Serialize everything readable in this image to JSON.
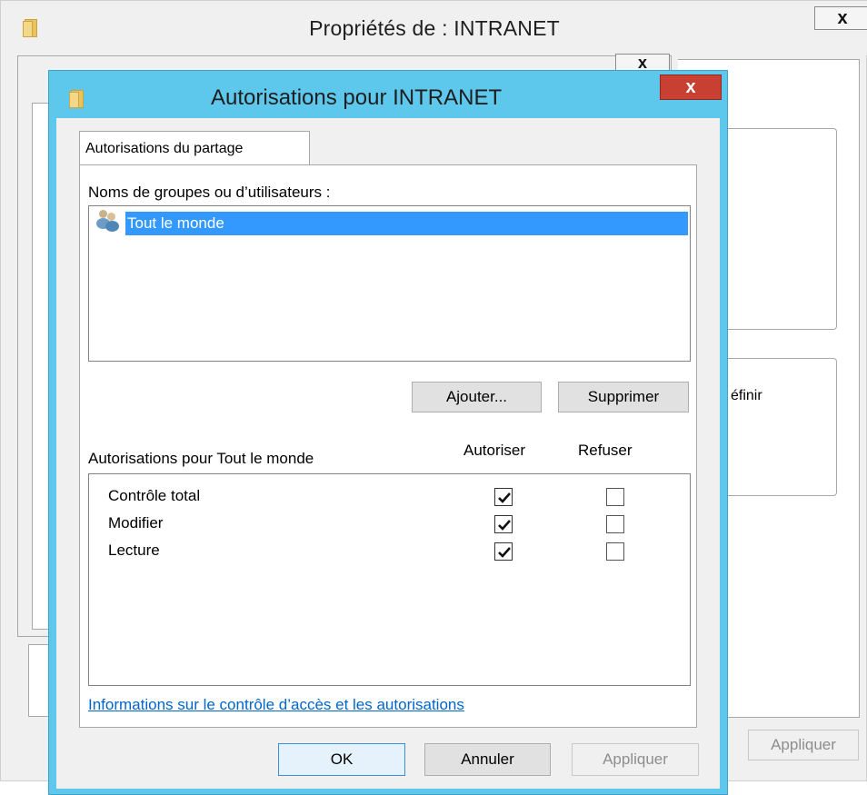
{
  "back_window": {
    "title": "Propriétés de : INTRANET",
    "close_label": "x",
    "mid_close_label": "x",
    "partial_text": "éfinir",
    "apply_label": "Appliquer"
  },
  "dialog": {
    "title": "Autorisations pour INTRANET",
    "close_label": "x",
    "tab_label": "Autorisations du partage",
    "groups_label": "Noms de groupes ou d’utilisateurs :",
    "groups": [
      {
        "name": "Tout le monde",
        "selected": true
      }
    ],
    "add_button": "Ajouter...",
    "remove_button": "Supprimer",
    "permissions_label": "Autorisations pour Tout le monde",
    "allow_header": "Autoriser",
    "deny_header": "Refuser",
    "permissions": [
      {
        "name": "Contrôle total",
        "allow": true,
        "deny": false
      },
      {
        "name": "Modifier",
        "allow": true,
        "deny": false
      },
      {
        "name": "Lecture",
        "allow": true,
        "deny": false
      }
    ],
    "info_link": "Informations sur le contrôle d’accès et les autorisations",
    "ok_button": "OK",
    "cancel_button": "Annuler",
    "apply_button": "Appliquer"
  },
  "colors": {
    "dialog_frame": "#5ec7ec",
    "selection": "#3399ff",
    "close_red": "#c84031",
    "link": "#0066cc"
  }
}
